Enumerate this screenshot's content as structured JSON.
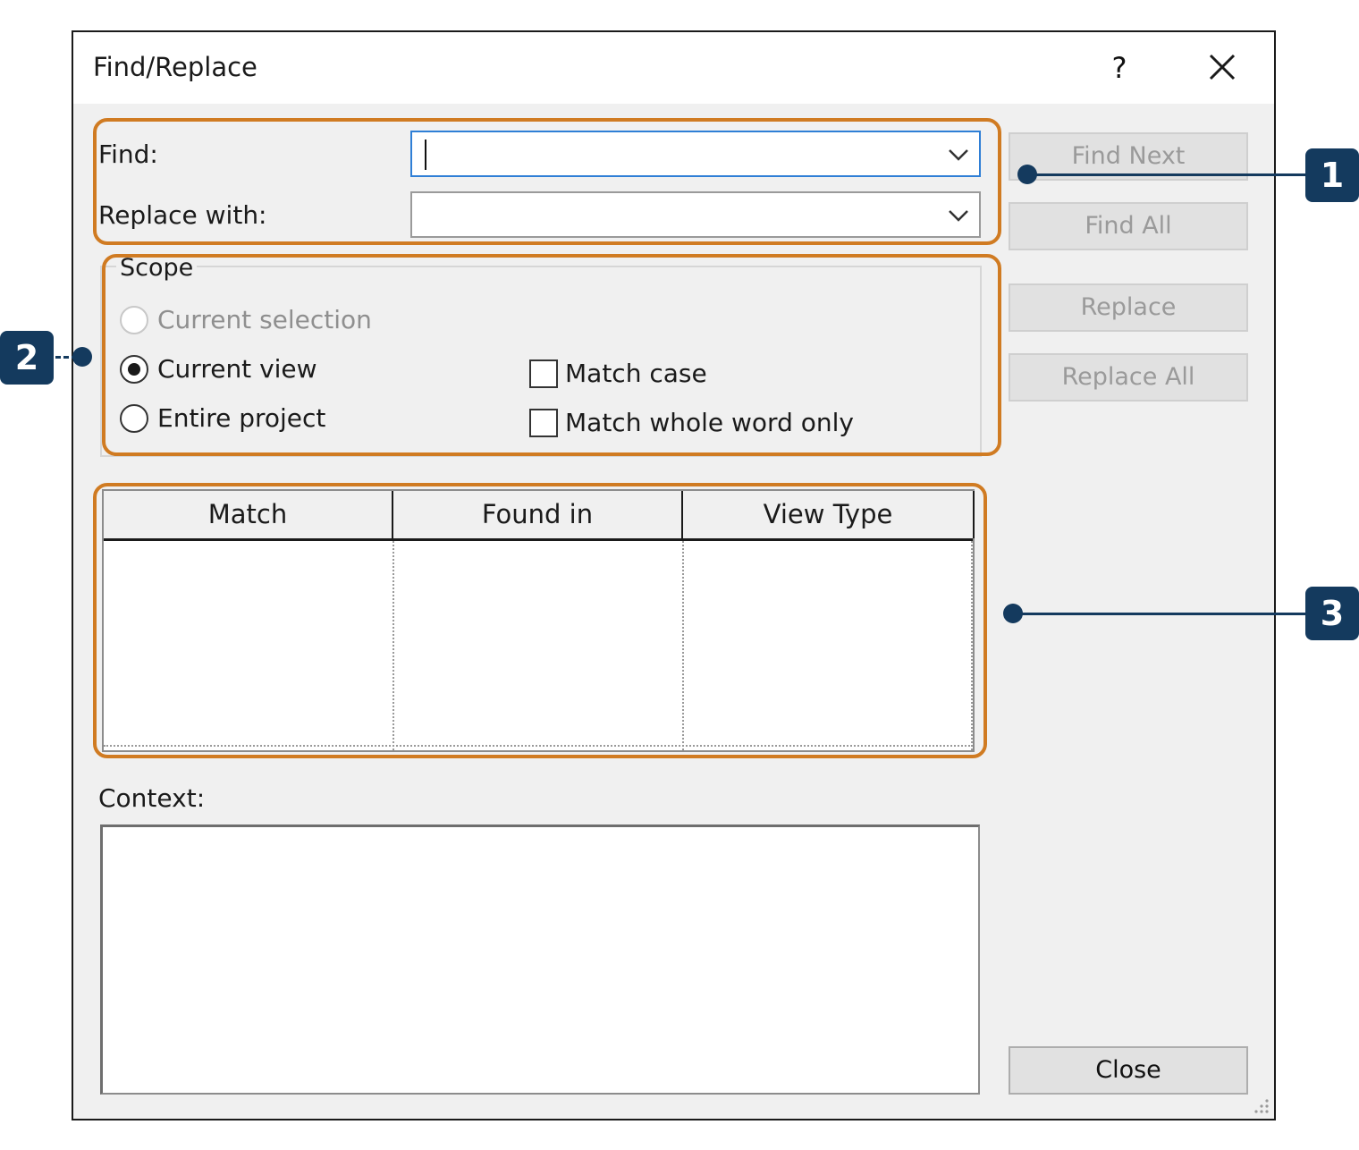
{
  "dialog": {
    "title": "Find/Replace",
    "help_label": "?"
  },
  "find": {
    "label": "Find:",
    "value": "",
    "replace_label": "Replace with:",
    "replace_value": ""
  },
  "scope": {
    "title": "Scope",
    "options": [
      {
        "label": "Current selection",
        "selected": false,
        "enabled": false
      },
      {
        "label": "Current view",
        "selected": true,
        "enabled": true
      },
      {
        "label": "Entire project",
        "selected": false,
        "enabled": true
      }
    ],
    "match_case_label": "Match case",
    "match_case_checked": false,
    "match_whole_word_label": "Match whole word only",
    "match_whole_word_checked": false
  },
  "buttons": {
    "find_next": "Find Next",
    "find_all": "Find All",
    "replace": "Replace",
    "replace_all": "Replace All",
    "close": "Close"
  },
  "results": {
    "columns": [
      "Match",
      "Found in",
      "View Type"
    ],
    "rows": []
  },
  "context": {
    "label": "Context:",
    "value": ""
  },
  "callouts": [
    "1",
    "2",
    "3"
  ],
  "colors": {
    "highlight": "#d07b22",
    "callout": "#143a5e",
    "focus": "#2f7fd6"
  }
}
